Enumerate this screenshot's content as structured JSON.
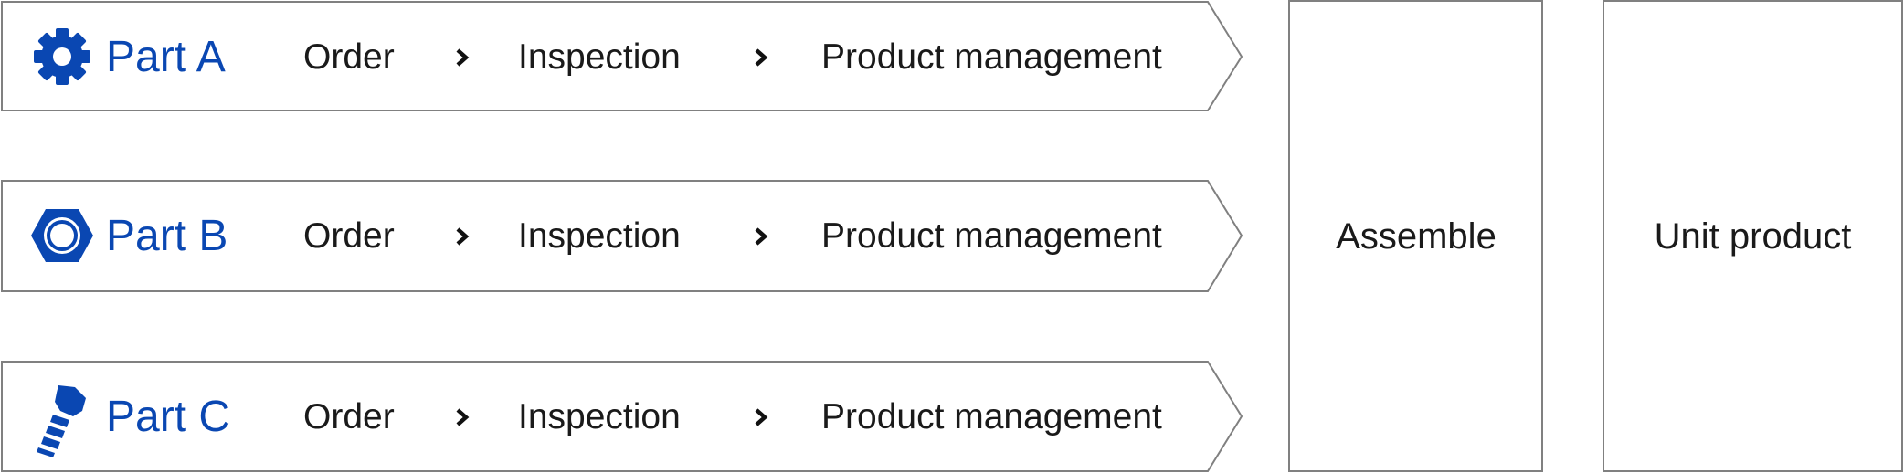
{
  "colors": {
    "accent": "#0a47b2",
    "text": "#1a1a1a",
    "border": "#808080"
  },
  "rows": [
    {
      "part_label": "Part A",
      "icon": "gear-icon",
      "steps": [
        "Order",
        "Inspection",
        "Product management"
      ]
    },
    {
      "part_label": "Part B",
      "icon": "hex-nut-icon",
      "steps": [
        "Order",
        "Inspection",
        "Product management"
      ]
    },
    {
      "part_label": "Part C",
      "icon": "bolt-icon",
      "steps": [
        "Order",
        "Inspection",
        "Product management"
      ]
    }
  ],
  "assemble_label": "Assemble",
  "unit_product_label": "Unit product"
}
